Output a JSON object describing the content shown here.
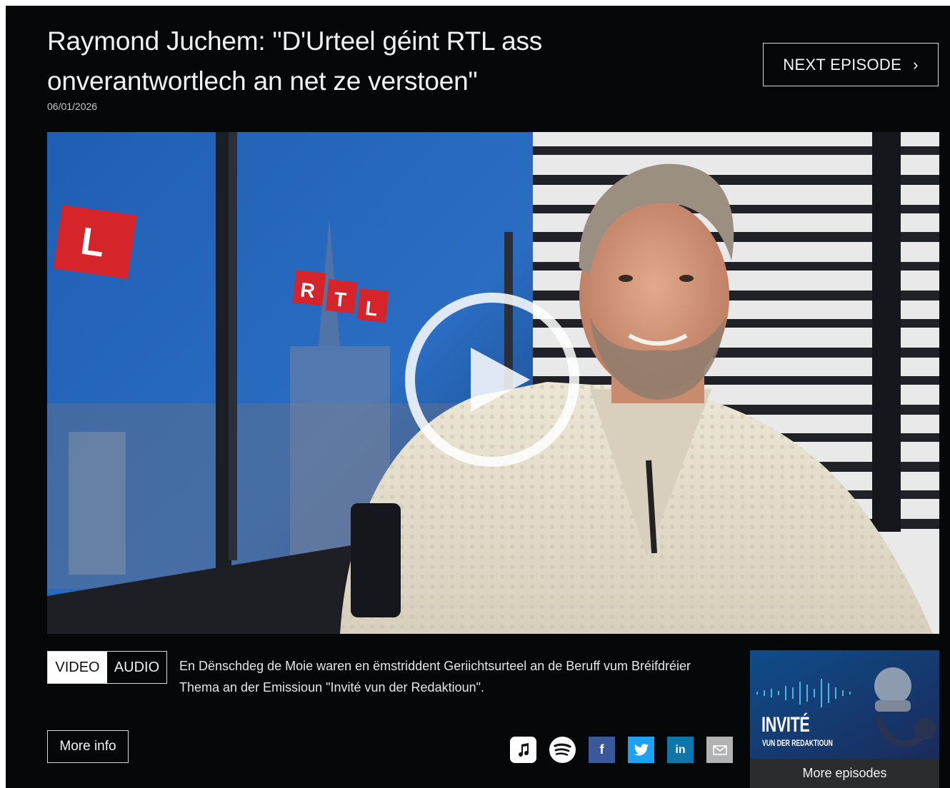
{
  "episode": {
    "title": "Raymond Juchem: \"D'Urteel géint RTL ass onverantwortlech an net ze verstoen\"",
    "date": "06/01/2026",
    "description": "En Dënschdeg de Moie waren en ëmstriddent Geriichtsurteel an de Beruff vum Bréifdréier Thema an der Emissioun \"Invité vun der Redaktioun\"."
  },
  "nav": {
    "next_label": "NEXT EPISODE"
  },
  "player": {
    "brand_text": "RTL",
    "modes": [
      "VIDEO",
      "AUDIO"
    ],
    "selected_mode": "VIDEO"
  },
  "actions": {
    "more_info_label": "More info"
  },
  "share": {
    "icons": [
      "apple-music-icon",
      "spotify-icon",
      "facebook-icon",
      "twitter-icon",
      "linkedin-icon",
      "mail-icon"
    ],
    "facebook_label": "f",
    "linkedin_label": "in"
  },
  "podcast": {
    "title": "INVITÉ",
    "subtitle": "VUN DER REDAKTIOUN",
    "more_label": "More episodes"
  },
  "colors": {
    "background": "#060708",
    "text": "#f1f1f1",
    "rtl_red": "#d6242b",
    "facebook": "#3b5998",
    "twitter": "#1da1f2",
    "linkedin": "#0e76a8"
  }
}
